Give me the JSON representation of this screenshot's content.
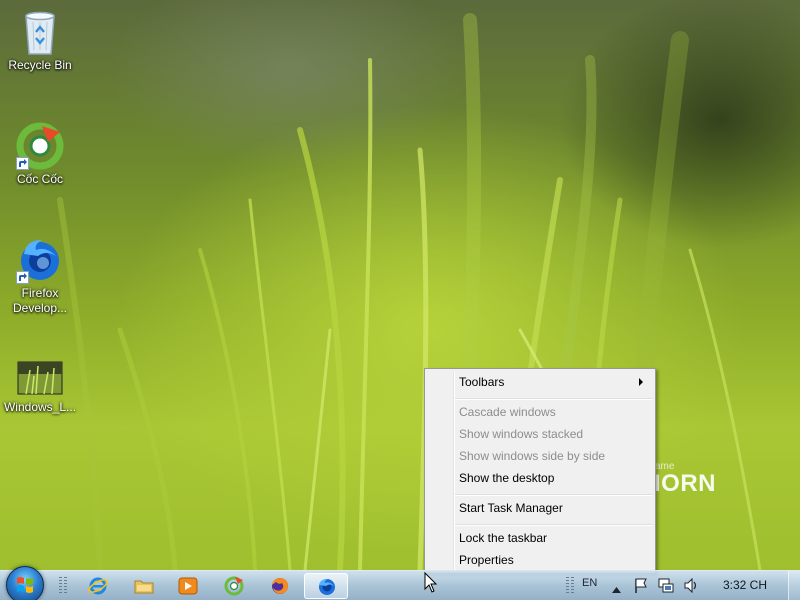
{
  "desktop": {
    "watermark": {
      "line1": "ame",
      "line2": "IORN"
    },
    "icons": [
      {
        "name": "recycle-bin",
        "label": "Recycle Bin",
        "shortcut": false,
        "icon": "recycle-bin-icon"
      },
      {
        "name": "coc-coc",
        "label": "Cốc Cốc",
        "shortcut": true,
        "icon": "coc-coc-icon"
      },
      {
        "name": "firefox-developer",
        "label": "Firefox\nDevelop...",
        "line1": "Firefox",
        "line2": "Develop...",
        "shortcut": true,
        "icon": "firefox-developer-icon"
      },
      {
        "name": "windows-l",
        "label": "Windows_L...",
        "shortcut": false,
        "icon": "image-thumbnail-icon"
      }
    ]
  },
  "context_menu": {
    "items": [
      {
        "label": "Toolbars",
        "enabled": true,
        "submenu": true
      },
      {
        "label": "Cascade windows",
        "enabled": false
      },
      {
        "label": "Show windows stacked",
        "enabled": false
      },
      {
        "label": "Show windows side by side",
        "enabled": false
      },
      {
        "label": "Show the desktop",
        "enabled": true
      },
      {
        "label": "Start Task Manager",
        "enabled": true
      },
      {
        "label": "Lock the taskbar",
        "enabled": true
      },
      {
        "label": "Properties",
        "enabled": true
      }
    ]
  },
  "taskbar": {
    "pinned": [
      {
        "name": "internet-explorer",
        "icon": "internet-explorer-icon",
        "active": false
      },
      {
        "name": "file-explorer",
        "icon": "folder-icon",
        "active": false
      },
      {
        "name": "media-player",
        "icon": "media-player-icon",
        "active": false
      },
      {
        "name": "coc-coc",
        "icon": "coc-coc-icon",
        "active": false
      },
      {
        "name": "firefox",
        "icon": "firefox-icon",
        "active": false
      },
      {
        "name": "firefox-developer",
        "icon": "firefox-developer-icon",
        "active": true
      }
    ],
    "tray": {
      "language": "EN",
      "clock": "3:32 CH",
      "icons": [
        "show-hidden-icons-arrow",
        "action-center-flag-icon",
        "network-icon",
        "volume-icon"
      ]
    }
  },
  "colors": {
    "menu_bg": "#f0f0f0",
    "menu_disabled_text": "#8d8d8d",
    "wallpaper_green": "#9fbf2e"
  }
}
